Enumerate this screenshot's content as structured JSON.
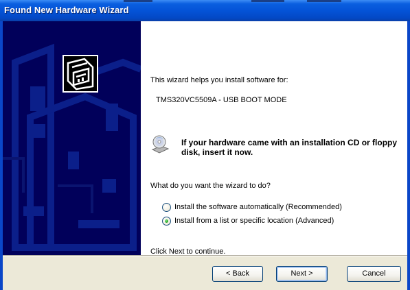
{
  "window": {
    "title": "Found New Hardware Wizard"
  },
  "content": {
    "intro_text": "This wizard helps you install software for:",
    "device_name": "TMS320VC5509A - USB BOOT MODE",
    "cd_prompt": "If your hardware came with an installation CD or floppy disk, insert it now.",
    "question": "What do you want the wizard to do?",
    "options": [
      {
        "label": "Install the software automatically (Recommended)",
        "selected": false
      },
      {
        "label": "Install from a list or specific location (Advanced)",
        "selected": true
      }
    ],
    "continue_text": "Click Next to continue."
  },
  "buttons": {
    "back_label": "< Back",
    "next_label": "Next >",
    "cancel_label": "Cancel"
  },
  "icons": {
    "wizard_logo": "hardware-wizard-icon",
    "cd_icon": "cd-disc-icon",
    "radio_selected": "radio-selected-icon",
    "radio_unselected": "radio-unselected-icon"
  },
  "colors": {
    "titlebar": "#0453d7",
    "side_panel": "#01005a",
    "content_bg": "#ffffff",
    "dialog_bg": "#ece9d8"
  }
}
